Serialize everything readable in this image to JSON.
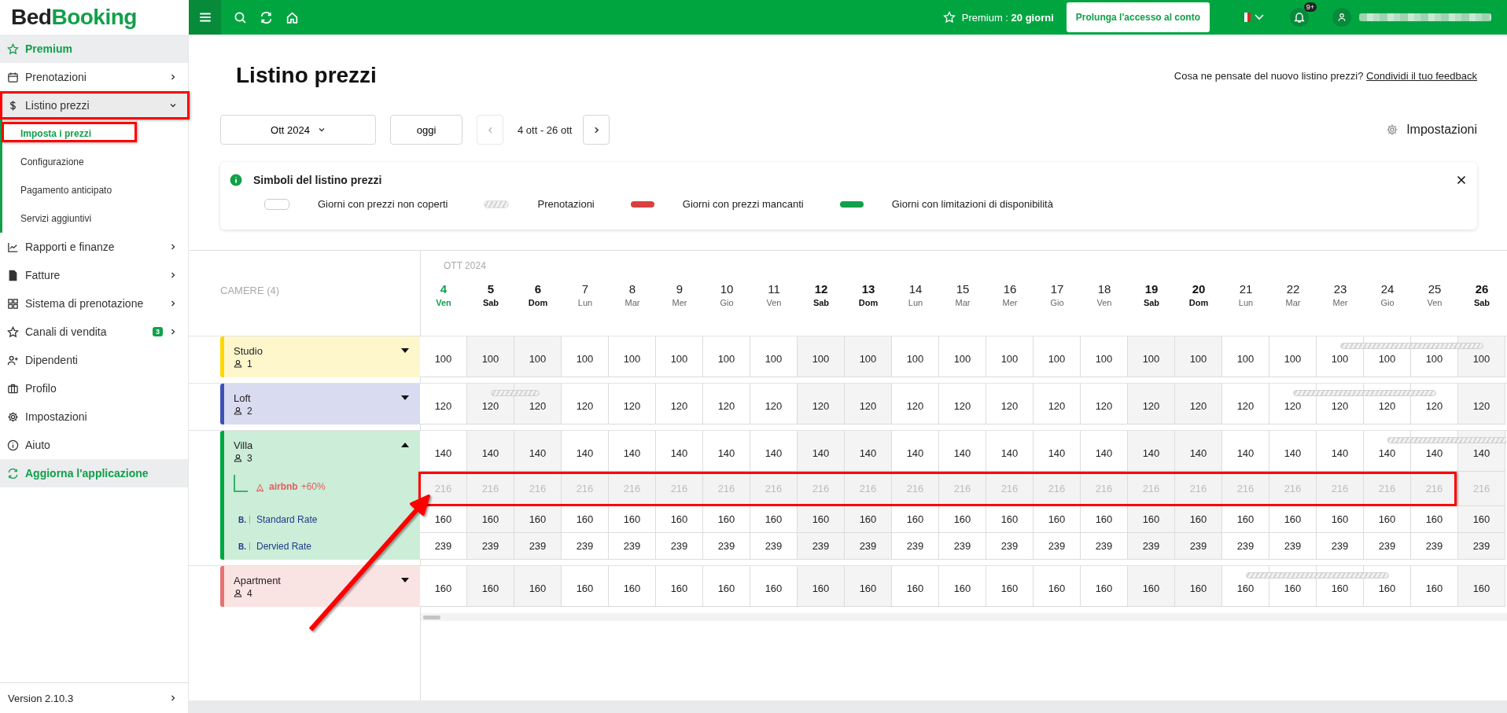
{
  "brand": {
    "first": "Bed",
    "second": "Booking"
  },
  "topbar": {
    "premium": "Premium : **20 giorni**",
    "extend_button": "Prolunga l'accesso al conto",
    "notifications_badge": "9+"
  },
  "sidebar": {
    "items": [
      {
        "label": "Premium",
        "kind": "premium"
      },
      {
        "label": "Prenotazioni",
        "kind": "menu",
        "expanded": false,
        "annotated": false
      },
      {
        "label": "Listino prezzi",
        "kind": "menu",
        "expanded": true,
        "annotated": true,
        "children": [
          {
            "label": "Imposta i prezzi",
            "selected": true,
            "annotated": true
          },
          {
            "label": "Configurazione",
            "selected": false,
            "annotated": false
          },
          {
            "label": "Pagamento anticipato",
            "selected": false,
            "annotated": false
          },
          {
            "label": "Servizi aggiuntivi",
            "selected": false,
            "annotated": false
          }
        ]
      },
      {
        "label": "Rapporti e finanze",
        "kind": "menu",
        "expanded": false,
        "annotated": false
      },
      {
        "label": "Fatture",
        "kind": "menu",
        "expanded": false,
        "annotated": false
      },
      {
        "label": "Sistema di prenotazione",
        "kind": "menu",
        "expanded": false,
        "annotated": false
      },
      {
        "label": "Canali di vendita",
        "kind": "menu",
        "expanded": false,
        "annotated": false,
        "badge": "3"
      },
      {
        "label": "Dipendenti",
        "kind": "link"
      },
      {
        "label": "Profilo",
        "kind": "link"
      },
      {
        "label": "Impostazioni",
        "kind": "link"
      },
      {
        "label": "Aiuto",
        "kind": "link"
      },
      {
        "label": "Aggiorna l'applicazione",
        "kind": "update"
      }
    ],
    "version": "Version 2.10.3"
  },
  "page": {
    "title": "Listino prezzi",
    "feedback_prompt": "Cosa ne pensate del nuovo listino prezzi?",
    "feedback_link": "Condividi il tuo feedback",
    "month_select": "Ott 2024",
    "today_button": "oggi",
    "range": "4 ott - 26 ott",
    "settings": "Impostazioni"
  },
  "legend": {
    "title": "Simboli del listino prezzi",
    "items": [
      {
        "label": "Giorni con prezzi non coperti",
        "kind": "empty"
      },
      {
        "label": "Prenotazioni",
        "kind": "booking"
      },
      {
        "label": "Giorni con prezzi mancanti",
        "kind": "missing"
      },
      {
        "label": "Giorni con limitazioni di disponibilità",
        "kind": "limited"
      }
    ]
  },
  "grid": {
    "month": "OTT 2024",
    "rooms_header": "CAMERE (4)",
    "days": [
      {
        "day": "4",
        "weekday": "Ven",
        "weekend": false,
        "today": true
      },
      {
        "day": "5",
        "weekday": "Sab",
        "weekend": true,
        "today": false
      },
      {
        "day": "6",
        "weekday": "Dom",
        "weekend": true,
        "today": false
      },
      {
        "day": "7",
        "weekday": "Lun",
        "weekend": false,
        "today": false
      },
      {
        "day": "8",
        "weekday": "Mar",
        "weekend": false,
        "today": false
      },
      {
        "day": "9",
        "weekday": "Mer",
        "weekend": false,
        "today": false
      },
      {
        "day": "10",
        "weekday": "Gio",
        "weekend": false,
        "today": false
      },
      {
        "day": "11",
        "weekday": "Ven",
        "weekend": false,
        "today": false
      },
      {
        "day": "12",
        "weekday": "Sab",
        "weekend": true,
        "today": false
      },
      {
        "day": "13",
        "weekday": "Dom",
        "weekend": true,
        "today": false
      },
      {
        "day": "14",
        "weekday": "Lun",
        "weekend": false,
        "today": false
      },
      {
        "day": "15",
        "weekday": "Mar",
        "weekend": false,
        "today": false
      },
      {
        "day": "16",
        "weekday": "Mer",
        "weekend": false,
        "today": false
      },
      {
        "day": "17",
        "weekday": "Gio",
        "weekend": false,
        "today": false
      },
      {
        "day": "18",
        "weekday": "Ven",
        "weekend": false,
        "today": false
      },
      {
        "day": "19",
        "weekday": "Sab",
        "weekend": true,
        "today": false
      },
      {
        "day": "20",
        "weekday": "Dom",
        "weekend": true,
        "today": false
      },
      {
        "day": "21",
        "weekday": "Lun",
        "weekend": false,
        "today": false
      },
      {
        "day": "22",
        "weekday": "Mar",
        "weekend": false,
        "today": false
      },
      {
        "day": "23",
        "weekday": "Mer",
        "weekend": false,
        "today": false
      },
      {
        "day": "24",
        "weekday": "Gio",
        "weekend": false,
        "today": false
      },
      {
        "day": "25",
        "weekday": "Ven",
        "weekend": false,
        "today": false
      },
      {
        "day": "26",
        "weekday": "Sab",
        "weekend": true,
        "today": false
      }
    ],
    "rooms": [
      {
        "name": "Studio",
        "guests": "1",
        "color": "#ffd600",
        "expanded": false,
        "rows": [
          {
            "kind": "base",
            "annotated": false,
            "cells": [
              {
                "price": "100"
              },
              {
                "price": "100"
              },
              {
                "price": "100"
              },
              {
                "price": "100"
              },
              {
                "price": "100"
              },
              {
                "price": "100"
              },
              {
                "price": "100"
              },
              {
                "price": "100"
              },
              {
                "price": "100"
              },
              {
                "price": "100"
              },
              {
                "price": "100"
              },
              {
                "price": "100"
              },
              {
                "price": "100"
              },
              {
                "price": "100"
              },
              {
                "price": "100"
              },
              {
                "price": "100"
              },
              {
                "price": "100"
              },
              {
                "price": "100"
              },
              {
                "price": "100"
              },
              {
                "price": "100",
                "booked": true
              },
              {
                "price": "100",
                "booked": true
              },
              {
                "price": "100",
                "booked": true
              },
              {
                "price": "100",
                "booked": true
              }
            ]
          }
        ]
      },
      {
        "name": "Loft",
        "guests": "2",
        "color": "#3f51b5",
        "expanded": false,
        "rows": [
          {
            "kind": "base",
            "annotated": false,
            "cells": [
              {
                "price": "120"
              },
              {
                "price": "120",
                "booked": true
              },
              {
                "price": "120",
                "booked": true
              },
              {
                "price": "120"
              },
              {
                "price": "120"
              },
              {
                "price": "120"
              },
              {
                "price": "120"
              },
              {
                "price": "120"
              },
              {
                "price": "120"
              },
              {
                "price": "120"
              },
              {
                "price": "120"
              },
              {
                "price": "120"
              },
              {
                "price": "120"
              },
              {
                "price": "120"
              },
              {
                "price": "120"
              },
              {
                "price": "120"
              },
              {
                "price": "120"
              },
              {
                "price": "120"
              },
              {
                "price": "120",
                "booked": true
              },
              {
                "price": "120",
                "booked": true
              },
              {
                "price": "120",
                "booked": true
              },
              {
                "price": "120",
                "booked": true
              },
              {
                "price": "120"
              }
            ]
          }
        ]
      },
      {
        "name": "Villa",
        "guests": "3",
        "color": "#00a63e",
        "expanded": true,
        "rows": [
          {
            "kind": "base",
            "annotated": false,
            "cells": [
              {
                "price": "140"
              },
              {
                "price": "140"
              },
              {
                "price": "140"
              },
              {
                "price": "140"
              },
              {
                "price": "140"
              },
              {
                "price": "140"
              },
              {
                "price": "140"
              },
              {
                "price": "140"
              },
              {
                "price": "140"
              },
              {
                "price": "140"
              },
              {
                "price": "140"
              },
              {
                "price": "140"
              },
              {
                "price": "140"
              },
              {
                "price": "140"
              },
              {
                "price": "140"
              },
              {
                "price": "140"
              },
              {
                "price": "140"
              },
              {
                "price": "140"
              },
              {
                "price": "140"
              },
              {
                "price": "140"
              },
              {
                "price": "140",
                "booked": true
              },
              {
                "price": "140",
                "booked": true
              },
              {
                "price": "140",
                "booked": true,
                "continues": true
              }
            ]
          },
          {
            "kind": "channel",
            "label": "airbnb",
            "surcharge": "+60%",
            "annotated": true,
            "cells": [
              {
                "price": "216"
              },
              {
                "price": "216"
              },
              {
                "price": "216"
              },
              {
                "price": "216"
              },
              {
                "price": "216"
              },
              {
                "price": "216"
              },
              {
                "price": "216"
              },
              {
                "price": "216"
              },
              {
                "price": "216"
              },
              {
                "price": "216"
              },
              {
                "price": "216"
              },
              {
                "price": "216"
              },
              {
                "price": "216"
              },
              {
                "price": "216"
              },
              {
                "price": "216"
              },
              {
                "price": "216"
              },
              {
                "price": "216"
              },
              {
                "price": "216"
              },
              {
                "price": "216"
              },
              {
                "price": "216"
              },
              {
                "price": "216"
              },
              {
                "price": "216"
              },
              {
                "price": "216"
              }
            ]
          },
          {
            "kind": "rate",
            "mark": "B.",
            "label": "Standard Rate",
            "annotated": false,
            "cells": [
              {
                "price": "160"
              },
              {
                "price": "160"
              },
              {
                "price": "160"
              },
              {
                "price": "160"
              },
              {
                "price": "160"
              },
              {
                "price": "160"
              },
              {
                "price": "160"
              },
              {
                "price": "160"
              },
              {
                "price": "160"
              },
              {
                "price": "160"
              },
              {
                "price": "160"
              },
              {
                "price": "160"
              },
              {
                "price": "160"
              },
              {
                "price": "160"
              },
              {
                "price": "160"
              },
              {
                "price": "160"
              },
              {
                "price": "160"
              },
              {
                "price": "160"
              },
              {
                "price": "160"
              },
              {
                "price": "160"
              },
              {
                "price": "160"
              },
              {
                "price": "160"
              },
              {
                "price": "160"
              }
            ]
          },
          {
            "kind": "rate",
            "mark": "B.",
            "label": "Dervied Rate",
            "annotated": false,
            "cells": [
              {
                "price": "239"
              },
              {
                "price": "239"
              },
              {
                "price": "239"
              },
              {
                "price": "239"
              },
              {
                "price": "239"
              },
              {
                "price": "239"
              },
              {
                "price": "239"
              },
              {
                "price": "239"
              },
              {
                "price": "239"
              },
              {
                "price": "239"
              },
              {
                "price": "239"
              },
              {
                "price": "239"
              },
              {
                "price": "239"
              },
              {
                "price": "239"
              },
              {
                "price": "239"
              },
              {
                "price": "239"
              },
              {
                "price": "239"
              },
              {
                "price": "239"
              },
              {
                "price": "239"
              },
              {
                "price": "239"
              },
              {
                "price": "239"
              },
              {
                "price": "239"
              },
              {
                "price": "239"
              }
            ]
          }
        ]
      },
      {
        "name": "Apartment",
        "guests": "4",
        "color": "#e57373",
        "expanded": false,
        "rows": [
          {
            "kind": "base",
            "annotated": false,
            "cells": [
              {
                "price": "160"
              },
              {
                "price": "160"
              },
              {
                "price": "160"
              },
              {
                "price": "160"
              },
              {
                "price": "160"
              },
              {
                "price": "160"
              },
              {
                "price": "160"
              },
              {
                "price": "160"
              },
              {
                "price": "160"
              },
              {
                "price": "160"
              },
              {
                "price": "160"
              },
              {
                "price": "160"
              },
              {
                "price": "160"
              },
              {
                "price": "160"
              },
              {
                "price": "160"
              },
              {
                "price": "160"
              },
              {
                "price": "160"
              },
              {
                "price": "160",
                "booked": true
              },
              {
                "price": "160",
                "booked": true
              },
              {
                "price": "160",
                "booked": true
              },
              {
                "price": "160",
                "booked": true
              },
              {
                "price": "160"
              },
              {
                "price": "160"
              }
            ]
          }
        ]
      }
    ]
  }
}
